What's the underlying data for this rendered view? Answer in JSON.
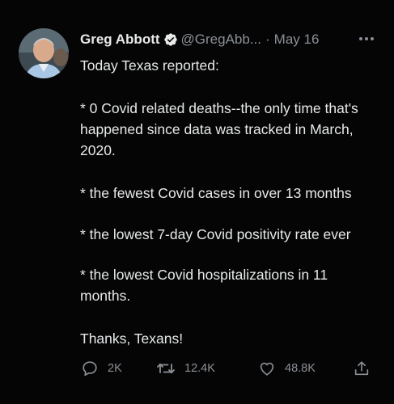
{
  "tweet": {
    "author_name": "Greg Abbott",
    "handle": "@GregAbb...",
    "separator": "·",
    "date": "May 16",
    "paragraphs": [
      "Today Texas reported:",
      "* 0 Covid related deaths--the only time that's happened since data was tracked in March, 2020.",
      "* the fewest Covid cases in over 13 months",
      "* the lowest 7-day Covid positivity rate ever",
      "* the lowest Covid hospitalizations in 11 months.",
      "Thanks, Texans!"
    ],
    "actions": {
      "reply_count": "2K",
      "retweet_count": "12.4K",
      "like_count": "48.8K"
    }
  },
  "icons": {
    "verified": "verified-badge-icon",
    "more": "more-options-icon",
    "reply": "reply-icon",
    "retweet": "retweet-icon",
    "like": "heart-icon",
    "share": "share-icon"
  },
  "colors": {
    "background": "#000000",
    "text_primary": "#e7e9ea",
    "text_secondary": "#8b9096",
    "verified_badge": "#e7e9ea"
  }
}
